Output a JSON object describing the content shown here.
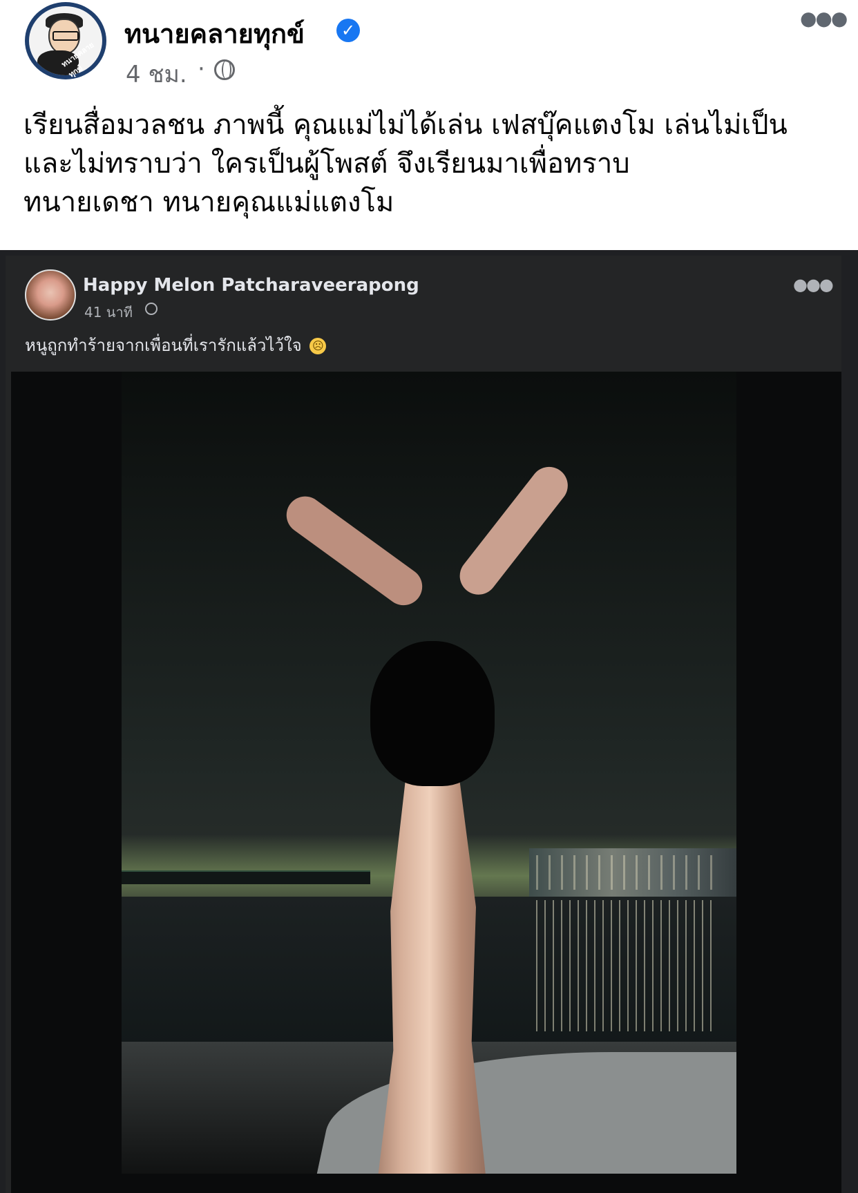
{
  "header": {
    "page_name": "ทนายคลายทุกข์",
    "time": "4 ชม.",
    "visibility_separator": "·",
    "avatar_text": "ทนายคลายทุกข์"
  },
  "caption": {
    "line1": "เรียนสื่อมวลชน ภาพนี้ คุณแม่ไม่ได้เล่น เฟสบุ๊คแตงโม เล่นไม่เป็น",
    "line2": "และไม่ทราบว่า ใครเป็นผู้โพสต์ จึงเรียนมาเพื่อทราบ",
    "line3": "ทนายเดชา ทนายคุณแม่แตงโม"
  },
  "embedded_post": {
    "author": "Happy Melon Patcharaveerapong",
    "time": "41 นาที",
    "text": "หนูถูกทำร้ายจากเพื่อนที่เรารักแล้วไว้ใจ",
    "emoji": "sad-face"
  },
  "colors": {
    "text_primary": "#050505",
    "text_secondary": "#65676b",
    "verified_blue": "#1877f2",
    "dark_embed_bg": "#242526"
  },
  "icons": {
    "verified": "verified-badge-icon",
    "public": "globe-icon",
    "more": "more-icon"
  }
}
